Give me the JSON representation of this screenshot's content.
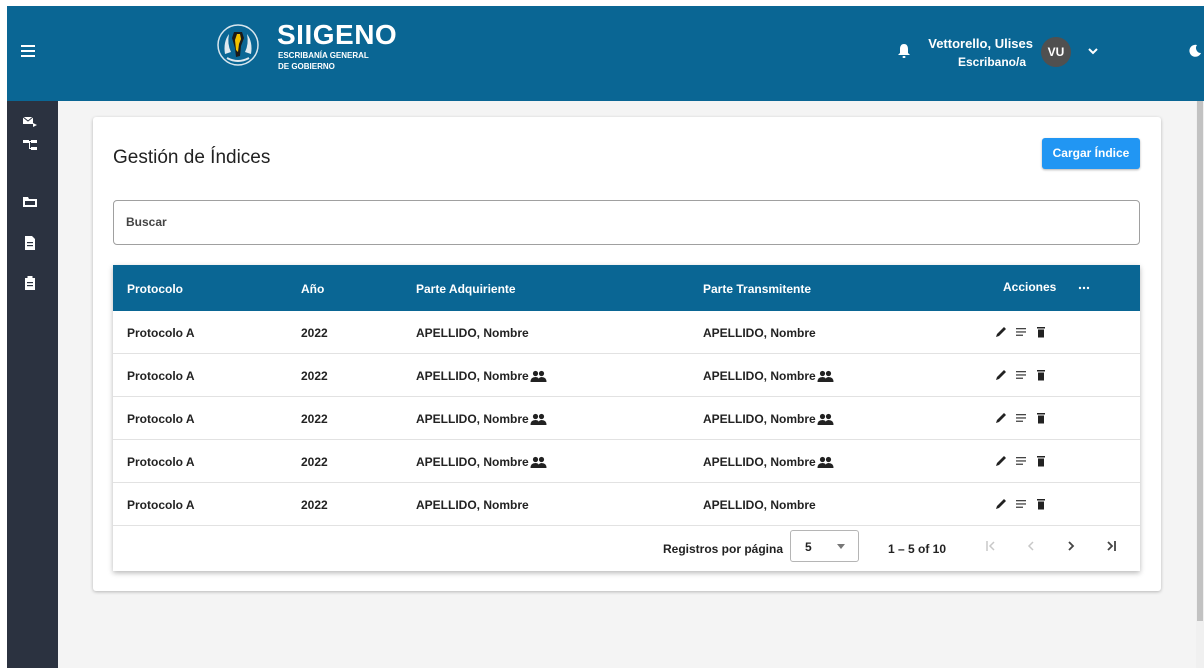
{
  "header": {
    "brand_title": "SIIGENO",
    "brand_sub_1": "ESCRIBANÍA GENERAL",
    "brand_sub_2": "DE GOBIERNO",
    "user_name": "Vettorello, Ulises",
    "user_role": "Escribano/a",
    "avatar_initials": "VU"
  },
  "sidebar": {
    "items": [
      {
        "icon": "mail-send-icon"
      },
      {
        "icon": "hierarchy-icon"
      },
      {
        "icon": "folder-icon"
      },
      {
        "icon": "document-icon"
      },
      {
        "icon": "clipboard-icon"
      }
    ]
  },
  "main": {
    "title": "Gestión de Índices",
    "load_button": "Cargar Índice",
    "search_placeholder": "Buscar"
  },
  "table": {
    "headers": [
      "Protocolo",
      "Año",
      "Parte Adquiriente",
      "Parte Transmitente",
      "Acciones"
    ],
    "rows": [
      {
        "protocolo": "Protocolo A",
        "anio": "2022",
        "adquiriente": "APELLIDO, Nombre",
        "transmitente": "APELLIDO, Nombre",
        "multiple": false
      },
      {
        "protocolo": "Protocolo A",
        "anio": "2022",
        "adquiriente": "APELLIDO, Nombre",
        "transmitente": "APELLIDO, Nombre",
        "multiple": true
      },
      {
        "protocolo": "Protocolo A",
        "anio": "2022",
        "adquiriente": "APELLIDO, Nombre",
        "transmitente": "APELLIDO, Nombre",
        "multiple": true
      },
      {
        "protocolo": "Protocolo A",
        "anio": "2022",
        "adquiriente": "APELLIDO, Nombre",
        "transmitente": "APELLIDO, Nombre",
        "multiple": true
      },
      {
        "protocolo": "Protocolo A",
        "anio": "2022",
        "adquiriente": "APELLIDO, Nombre",
        "transmitente": "APELLIDO, Nombre",
        "multiple": false
      }
    ]
  },
  "pagination": {
    "label": "Registros por página",
    "page_size": "5",
    "range": "1 – 5 of 10"
  },
  "colors": {
    "header_bg": "#0a6694",
    "sidebar_bg": "#2b3240",
    "accent": "#2196f3"
  }
}
